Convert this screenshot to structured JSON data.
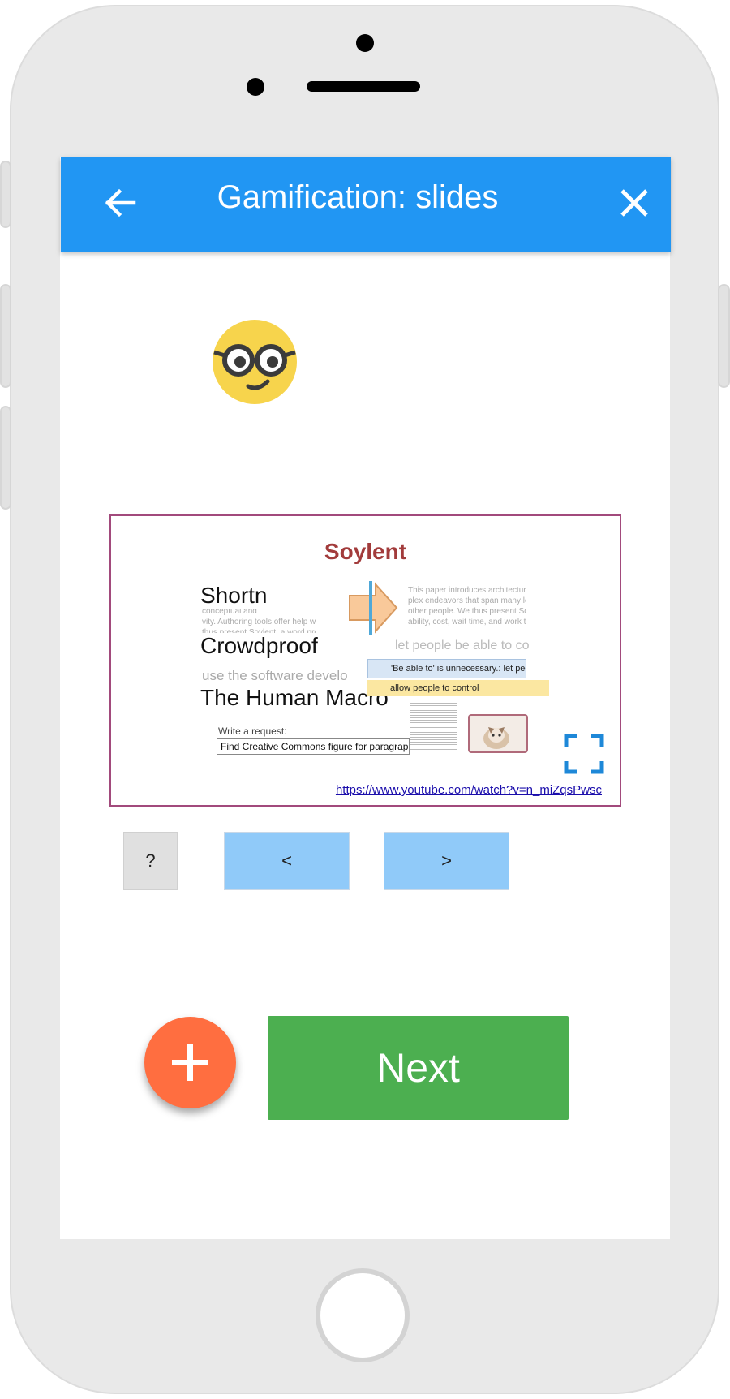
{
  "app": {
    "title": "Gamification: slides",
    "back_icon": "arrow-left-icon",
    "close_icon": "close-icon",
    "header_color": "#2196f3"
  },
  "emoji": {
    "icon": "nerd-face-emoji-icon"
  },
  "video": {
    "slide_title": "Soylent",
    "features": [
      "Shortn",
      "Crowdproof",
      "The Human Macro"
    ],
    "request_label": "Write a request:",
    "request_value": "Find Creative Commons figure for paragraph",
    "suggestion_1": "'Be able to' is unnecessary.: let people",
    "suggestion_2": "allow people to control",
    "inline_text": "let people be able to co",
    "link": "https://www.youtube.com/watch?v=n_miZqsPwsc",
    "fullscreen_icon": "fullscreen-icon",
    "border_color": "#a24a7c"
  },
  "controls": {
    "help_label": "?",
    "prev_label": "<",
    "next_label": ">"
  },
  "fab": {
    "icon": "plus-icon",
    "color": "#ff6e40"
  },
  "next_button": {
    "label": "Next",
    "color": "#4caf50"
  }
}
